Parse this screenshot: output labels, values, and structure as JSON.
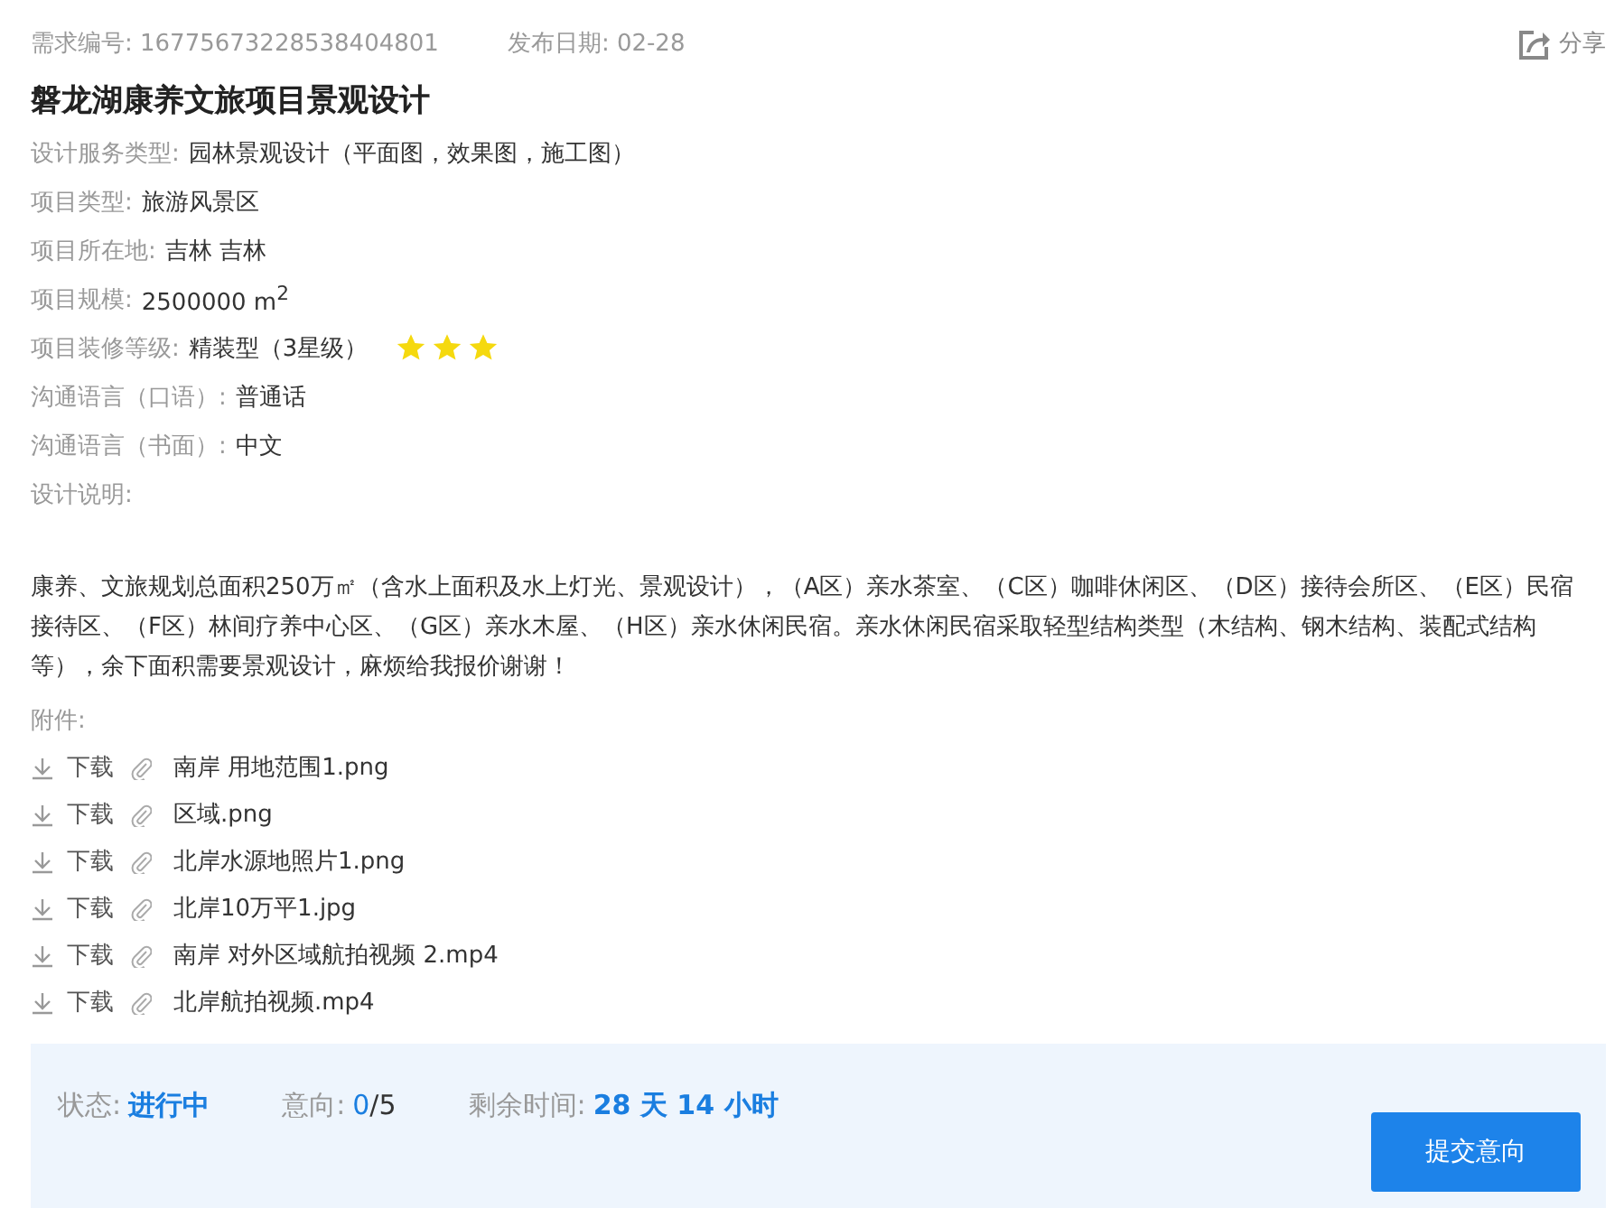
{
  "header": {
    "demand_no": "需求编号: 16775673228538404801",
    "publish_date": "发布日期: 02-28",
    "share": "分享"
  },
  "title": "磐龙湖康养文旅项目景观设计",
  "fields": [
    {
      "label": "设计服务类型:",
      "value": "园林景观设计（平面图，效果图，施工图）"
    },
    {
      "label": "项目类型:",
      "value": "旅游风景区"
    },
    {
      "label": "项目所在地:",
      "value": "吉林 吉林"
    },
    {
      "label": "项目规模:",
      "value": "2500000 m$^{2}$"
    },
    {
      "label": "项目装修等级:",
      "value": "精装型（3星级）",
      "stars": 3
    },
    {
      "label": "沟通语言（口语）:",
      "value": "普通话"
    },
    {
      "label": "沟通语言（书面）:",
      "value": "中文"
    },
    {
      "label": "设计说明:"
    }
  ],
  "description": "康养、文旅规划总面积250万㎡（含水上面积及水上灯光、景观设计），（A区）亲水茶室、（C区）咖啡休闲区、（D区）接待会所区、（E区）民宿接待区、（F区）林间疗养中心区、（G区）亲水木屋、（H区）亲水休闲民宿。亲水休闲民宿采取轻型结构类型（木结构、钢木结构、装配式结构等），余下面积需要景观设计，麻烦给我报价谢谢！",
  "attachments_label": "附件:",
  "attachments": [
    {
      "download": "下载",
      "file": "南岸 用地范围1.png"
    },
    {
      "download": "下载",
      "file": "区域.png"
    },
    {
      "download": "下载",
      "file": "北岸水源地照片1.png"
    },
    {
      "download": "下载",
      "file": "北岸10万平1.jpg"
    },
    {
      "download": "下载",
      "file": "南岸 对外区域航拍视频 2.mp4"
    },
    {
      "download": "下载",
      "file": "北岸航拍视频.mp4"
    }
  ],
  "status_panel": {
    "status_label": "状态:",
    "status": "进行中",
    "intent_label": "意向:",
    "intent_count": "0",
    "intent_total": "/5",
    "remaining_label": "剩余时间:",
    "remaining": "28 天 14 小时",
    "submit": "提交意向"
  }
}
